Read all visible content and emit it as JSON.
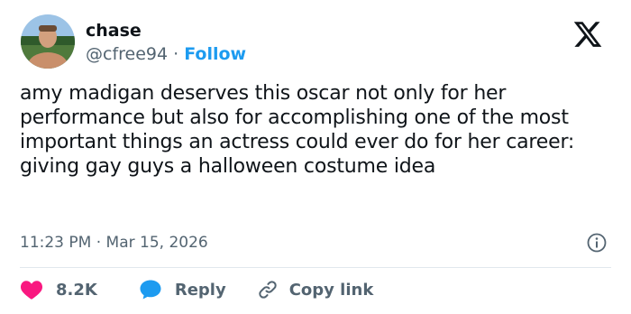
{
  "user": {
    "display_name": "chase",
    "handle": "@cfree94",
    "separator": " · ",
    "follow_label": "Follow"
  },
  "tweet": {
    "text": "amy madigan deserves this oscar not only for her performance but also for accomplishing one of the most important things an actress could ever do for her career: giving gay guys a halloween costume idea",
    "time": "11:23 PM",
    "date_separator": " · ",
    "date": "Mar 15, 2026"
  },
  "actions": {
    "like_count": "8.2K",
    "reply_label": "Reply",
    "copy_link_label": "Copy link"
  },
  "icons": {
    "brand": "x-logo-icon",
    "info": "info-icon",
    "like": "heart-icon",
    "reply": "speech-bubble-icon",
    "copy": "link-icon"
  },
  "colors": {
    "text": "#0f1419",
    "secondary": "#536471",
    "accent": "#1d9bf0",
    "like": "#f91880",
    "divider": "#e1e8ed"
  }
}
